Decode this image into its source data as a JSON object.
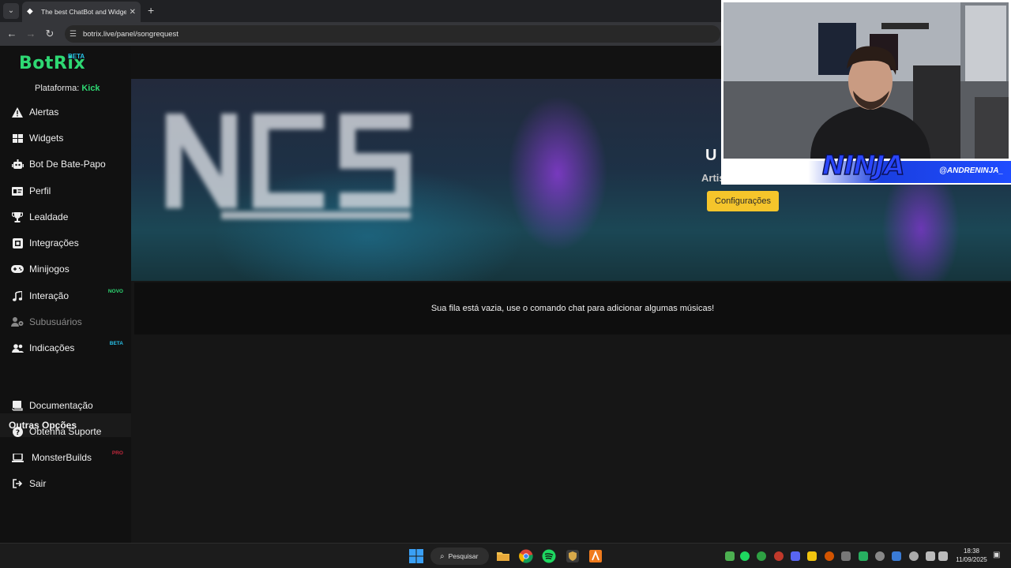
{
  "browser": {
    "tab_title": "The best ChatBot and Widgets",
    "url": "botrix.live/panel/songrequest"
  },
  "sidebar": {
    "logo_text": "BotRix",
    "logo_badge": "BETA",
    "platform_label": "Plataforma:",
    "platform_value": "Kick",
    "items": [
      {
        "label": "Alertas",
        "icon": "warning-icon"
      },
      {
        "label": "Widgets",
        "icon": "grid-icon"
      },
      {
        "label": "Bot De Bate-Papo",
        "icon": "robot-icon"
      },
      {
        "label": "Perfil",
        "icon": "id-card-icon"
      },
      {
        "label": "Lealdade",
        "icon": "trophy-icon"
      },
      {
        "label": "Integrações",
        "icon": "plug-icon"
      },
      {
        "label": "Minijogos",
        "icon": "gamepad-icon"
      },
      {
        "label": "Interação",
        "icon": "music-icon",
        "badge": "NOVO"
      },
      {
        "label": "Subusuários",
        "icon": "users-cog-icon"
      },
      {
        "label": "Indicações",
        "icon": "users-icon",
        "badge": "BETA"
      }
    ],
    "section_title": "Outras Opções",
    "other_items": [
      {
        "label": "Documentação",
        "icon": "book-icon"
      },
      {
        "label": "Obtenha Suporte",
        "icon": "question-icon"
      },
      {
        "label": "MonsterBuilds",
        "icon": "laptop-icon",
        "badge": "PRO"
      },
      {
        "label": "Sair",
        "icon": "logout-icon"
      }
    ],
    "colors": {
      "accent": "#2ed873",
      "badge_new": "#2ed873",
      "badge_beta": "#28c0e8",
      "badge_pro": "#c0283c"
    }
  },
  "player": {
    "title_visible": "U",
    "artist_visible": "Artis",
    "settings_button": "Configurações",
    "button_color": "#f5c52b"
  },
  "queue": {
    "empty_message": "Sua fila está vazia, use o comando chat para adicionar algumas músicas!"
  },
  "webcam": {
    "handle": "@ANDRENINJA_",
    "logo_text": "NINJA"
  },
  "taskbar": {
    "search_label": "Pesquisar",
    "time": "18:38",
    "date": "11/09/2025"
  }
}
